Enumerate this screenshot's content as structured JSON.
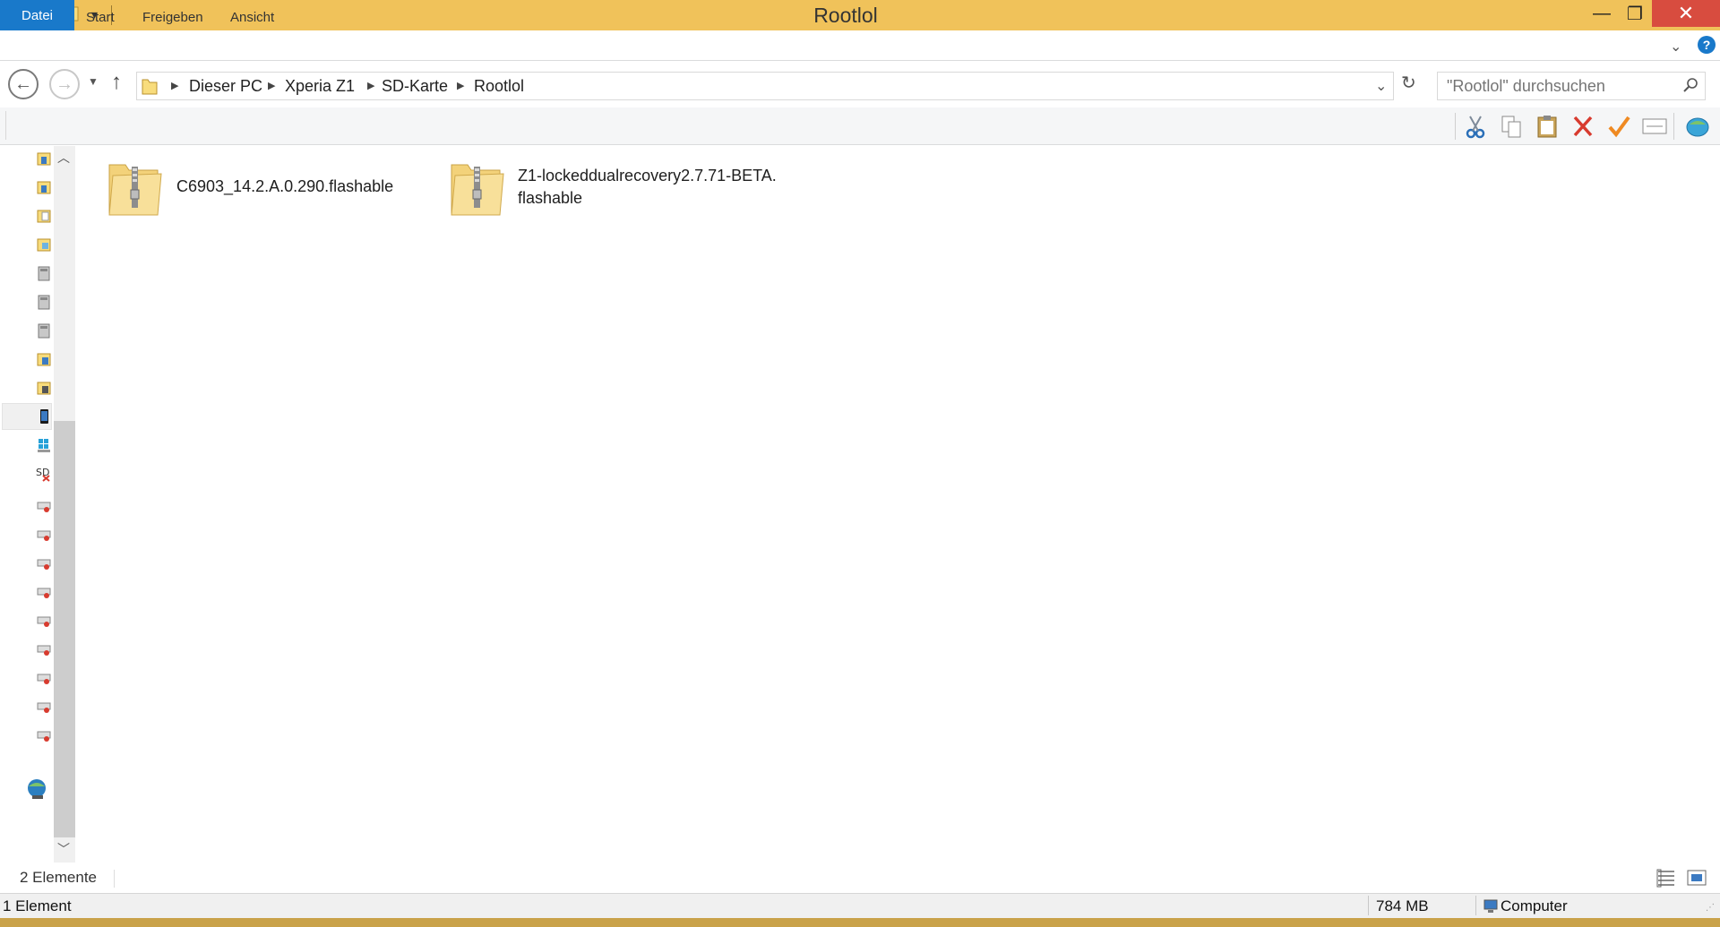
{
  "window": {
    "title": "Rootlol",
    "minimize_glyph": "—",
    "maximize_glyph": "❐",
    "close_glyph": "✕"
  },
  "ribbon": {
    "tabs": [
      {
        "label": "Datei",
        "active": true
      },
      {
        "label": "Start"
      },
      {
        "label": "Freigeben"
      },
      {
        "label": "Ansicht"
      }
    ],
    "help_glyph": "?"
  },
  "address": {
    "breadcrumbs": [
      "Dieser PC",
      "Xperia Z1",
      "SD-Karte",
      "Rootlol"
    ],
    "search_placeholder": "\"Rootlol\" durchsuchen"
  },
  "toolbar": {
    "icons": [
      "cut-icon",
      "copy-icon",
      "paste-icon",
      "delete-icon",
      "check-icon",
      "rename-icon",
      "globe-icon"
    ]
  },
  "files": [
    {
      "name_line1": "C6903_14.2.A.0.290.flashable",
      "name_line2": "",
      "icon": "zip-folder-icon"
    },
    {
      "name_line1": "Z1-lockeddualrecovery2.7.71-BETA.",
      "name_line2": "flashable",
      "icon": "zip-folder-icon"
    }
  ],
  "status": {
    "item_count": "2 Elemente",
    "selected": "1 Element",
    "size": "784 MB",
    "zone": "Computer"
  },
  "colors": {
    "titlebar": "#f0c25a",
    "file_tab": "#1979ca",
    "close_button": "#d84c3f"
  }
}
